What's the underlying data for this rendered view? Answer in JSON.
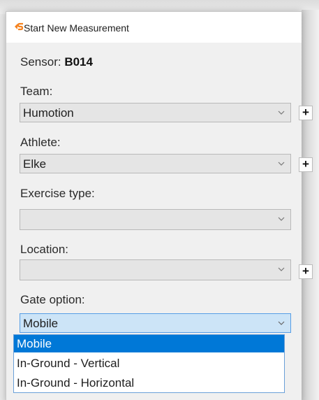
{
  "window": {
    "title": "Start New Measurement"
  },
  "sensor": {
    "label": "Sensor:",
    "value": "B014"
  },
  "team": {
    "label": "Team:",
    "value": "Humotion",
    "add_label": "+"
  },
  "athlete": {
    "label": "Athlete:",
    "value": "Elke",
    "add_label": "+"
  },
  "exercise": {
    "label": "Exercise type:",
    "value": ""
  },
  "location": {
    "label": "Location:",
    "value": "",
    "add_label": "+"
  },
  "gate": {
    "label": "Gate option:",
    "value": "Mobile",
    "options": [
      "Mobile",
      "In-Ground - Vertical",
      "In-Ground - Horizontal"
    ],
    "selected_index": 0
  },
  "colors": {
    "accent": "#0078d7",
    "logo": "#f5821f",
    "combo_bg": "#e5e5e5"
  },
  "icons": {
    "logo": "app-logo-icon",
    "dropdown": "chevron-down-icon",
    "add": "plus-icon"
  }
}
